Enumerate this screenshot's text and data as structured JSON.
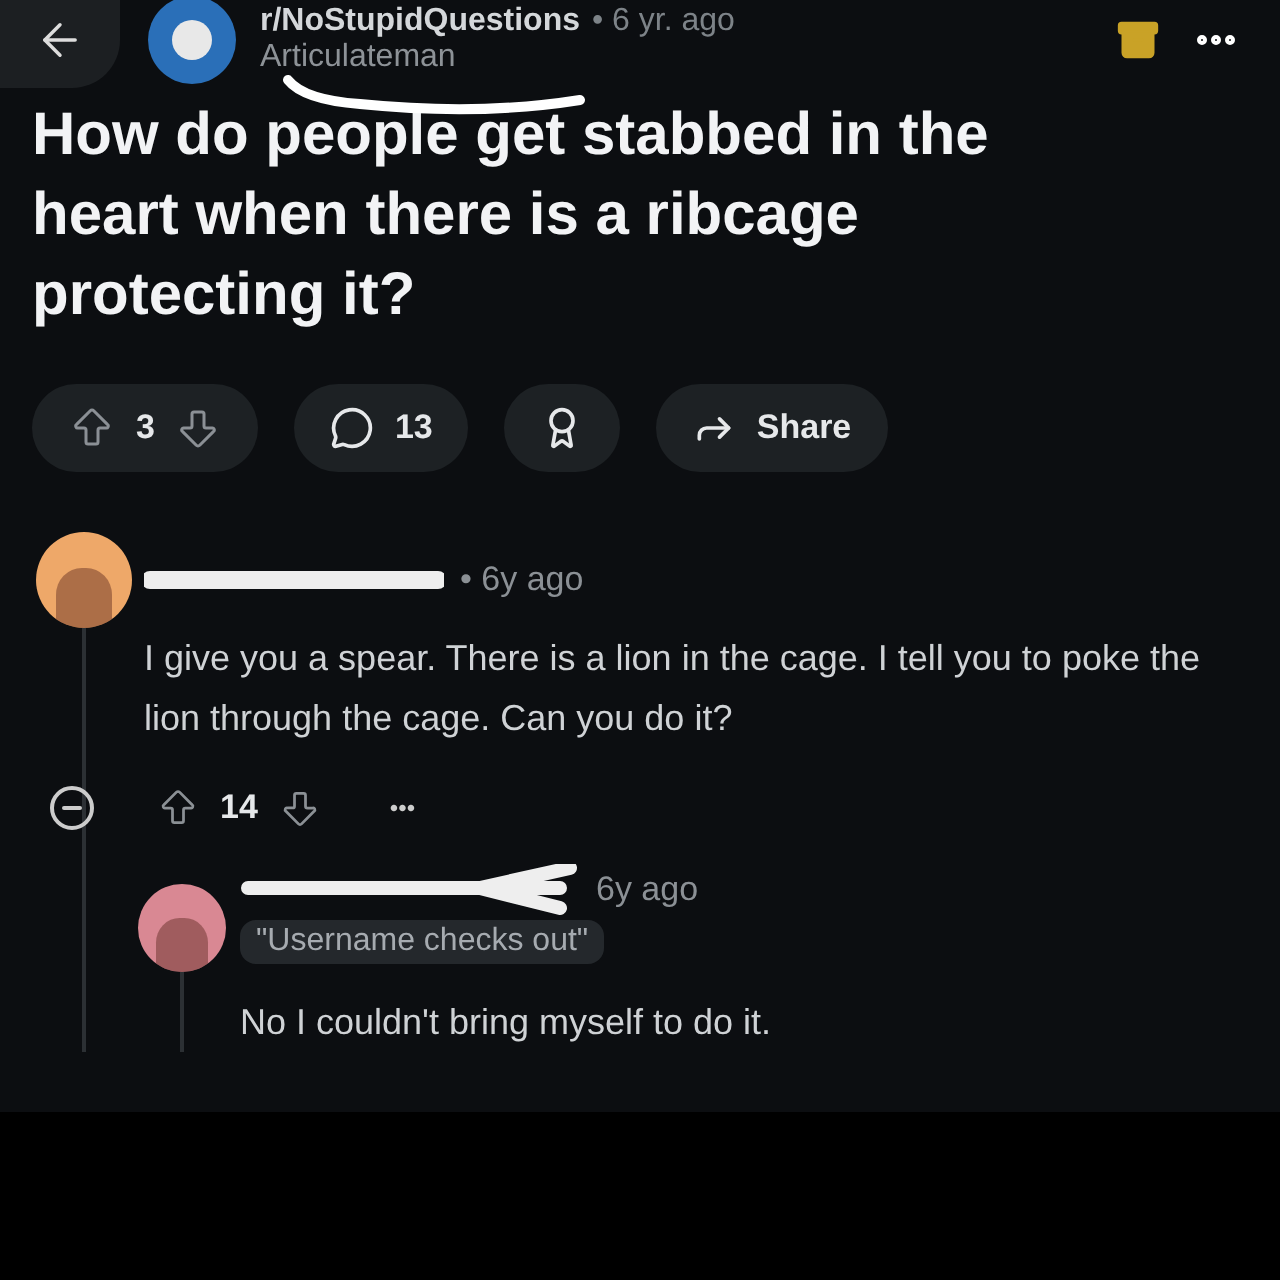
{
  "top_bar": {
    "subreddit": "r/NoStupidQuestions",
    "age": "• 6 yr. ago",
    "author": "Articulateman"
  },
  "post": {
    "title": "How do people get stabbed in the heart when there is a ribcage protecting it?",
    "votes": "3",
    "comments": "13",
    "share": "Share"
  },
  "comments": [
    {
      "color": "#eea869",
      "age": "• 6y ago",
      "body": "I give you a spear. There is a lion in the cage. I tell you to poke the lion through the cage. Can you do it?",
      "votes": "14",
      "more": "•••",
      "children": [
        {
          "color": "#d98893",
          "age": "6y ago",
          "flair": "\"Username checks out\"",
          "body": "No I couldn't bring myself to do it."
        }
      ]
    }
  ]
}
